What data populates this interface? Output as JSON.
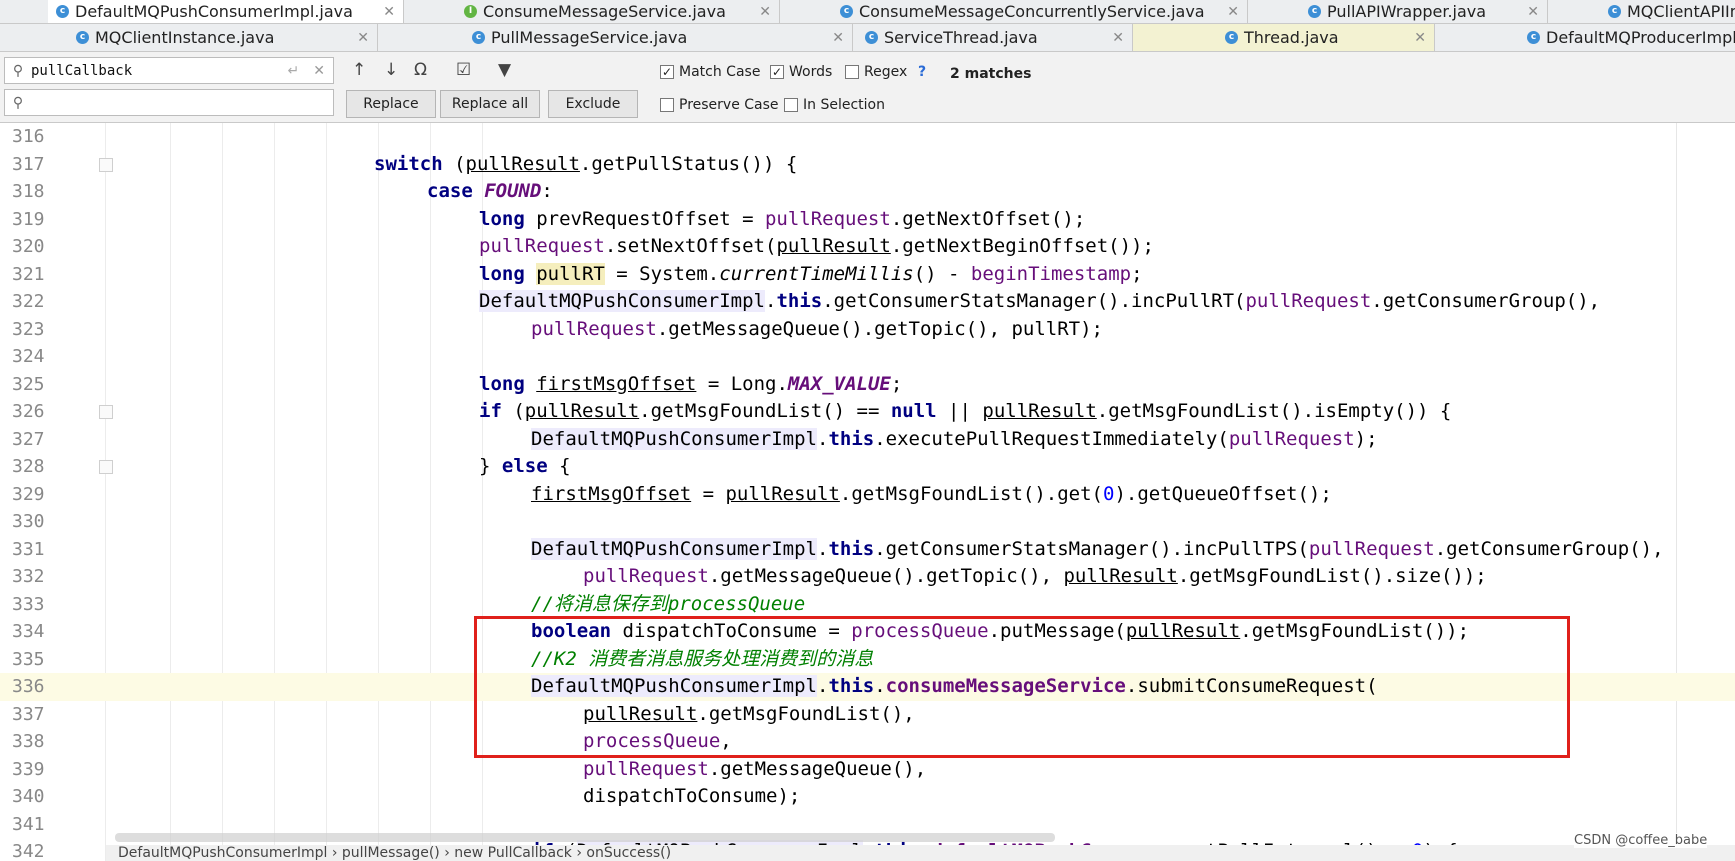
{
  "tabs_row1": [
    {
      "label": "DefaultMQPushConsumerImpl.java",
      "kind": "class",
      "active": true
    },
    {
      "label": "ConsumeMessageService.java",
      "kind": "interface"
    },
    {
      "label": "ConsumeMessageConcurrentlyService.java",
      "kind": "class"
    },
    {
      "label": "PullAPIWrapper.java",
      "kind": "class"
    },
    {
      "label": "MQClientAPIImpl",
      "kind": "class"
    }
  ],
  "tabs_row2": [
    {
      "label": "MQClientInstance.java",
      "kind": "class"
    },
    {
      "label": "PullMessageService.java",
      "kind": "class"
    },
    {
      "label": "ServiceThread.java",
      "kind": "class"
    },
    {
      "label": "Thread.java",
      "kind": "class",
      "highlighted": true
    },
    {
      "label": "DefaultMQProducerImpl.java",
      "kind": "class"
    }
  ],
  "find": {
    "search_value": "pullCallback",
    "replace_value": "",
    "match_case_label": "Match Case",
    "match_case_checked": true,
    "words_label": "Words",
    "words_checked": true,
    "regex_label": "Regex",
    "regex_checked": false,
    "help": "?",
    "matches": "2 matches",
    "replace_label": "Replace",
    "replace_all_label": "Replace all",
    "exclude_label": "Exclude",
    "preserve_case_label": "Preserve Case",
    "in_selection_label": "In Selection"
  },
  "editor": {
    "line_numbers": [
      "316",
      "317",
      "318",
      "319",
      "320",
      "321",
      "322",
      "323",
      "324",
      "325",
      "326",
      "327",
      "328",
      "329",
      "330",
      "331",
      "332",
      "333",
      "334",
      "335",
      "336",
      "337",
      "338",
      "339",
      "340",
      "341",
      "342"
    ],
    "caret_line": "336",
    "comment_333": "//将消息保存到processQueue",
    "comment_335": "//K2 消费者消息服务处理消费到的消息"
  },
  "breadcrumb": "DefaultMQPushConsumerImpl  ›  pullMessage()  ›  new PullCallback  ›  onSuccess()",
  "watermark": "CSDN @coffee_babe",
  "colors": {
    "keyword": "#000080",
    "field": "#660e7a",
    "comment": "#008000",
    "number": "#0000ff",
    "annotation_box": "#e0201b"
  }
}
